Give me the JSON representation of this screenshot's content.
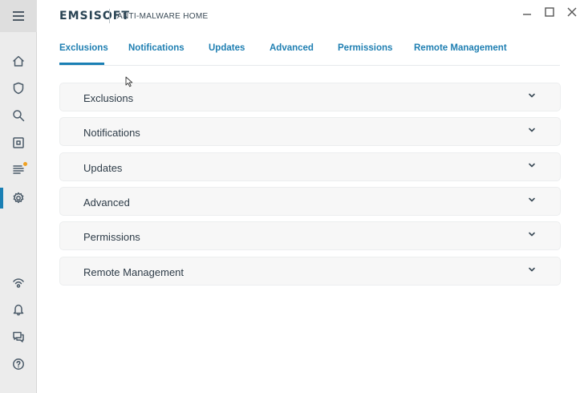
{
  "app": {
    "logo": "EMSISOFT",
    "product": "ANTI-MALWARE HOME"
  },
  "window_controls": [
    "minimize-icon",
    "maximize-icon",
    "close-icon"
  ],
  "sidebar": {
    "menu_icon": "hamburger-icon",
    "items": [
      {
        "icon": "home-icon",
        "active": false
      },
      {
        "icon": "shield-icon",
        "active": false
      },
      {
        "icon": "search-icon",
        "active": false
      },
      {
        "icon": "quarantine-icon",
        "active": false
      },
      {
        "icon": "logs-icon",
        "active": false,
        "badge_color": "#f0a020"
      },
      {
        "icon": "gear-icon",
        "active": true
      }
    ],
    "bottom_items": [
      {
        "icon": "connection-icon"
      },
      {
        "icon": "bell-icon"
      },
      {
        "icon": "chat-icon"
      },
      {
        "icon": "help-icon"
      }
    ]
  },
  "tabs": [
    {
      "label": "Exclusions",
      "active": true
    },
    {
      "label": "Notifications",
      "active": false
    },
    {
      "label": "Updates",
      "active": false
    },
    {
      "label": "Advanced",
      "active": false
    },
    {
      "label": "Permissions",
      "active": false
    },
    {
      "label": "Remote Management",
      "active": false
    }
  ],
  "panels": [
    {
      "label": "Exclusions",
      "expanded": false
    },
    {
      "label": "Notifications",
      "expanded": false
    },
    {
      "label": "Updates",
      "expanded": false
    },
    {
      "label": "Advanced",
      "expanded": false
    },
    {
      "label": "Permissions",
      "expanded": false
    },
    {
      "label": "Remote Management",
      "expanded": false
    }
  ],
  "colors": {
    "accent": "#1a7fb4",
    "sidebar_bg": "#ececec",
    "panel_bg": "#f7f7f7",
    "badge": "#f0a020"
  }
}
